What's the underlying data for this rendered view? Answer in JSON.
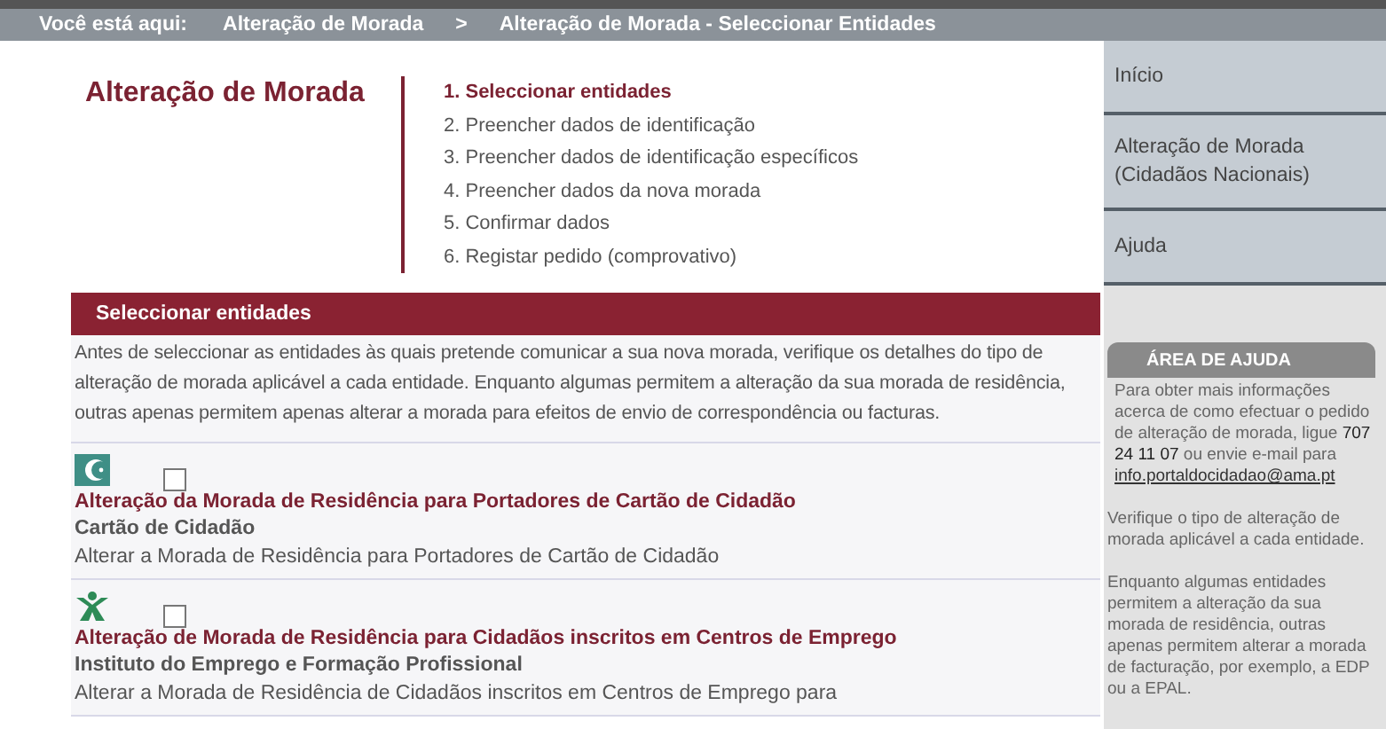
{
  "breadcrumb": {
    "label": "Você está aqui:",
    "items": [
      "Alteração de Morada",
      ">",
      "Alteração de Morada - Seleccionar Entidades"
    ]
  },
  "title": "Alteração de Morada",
  "steps": [
    {
      "label": "1. Seleccionar entidades",
      "selected": true
    },
    {
      "label": "2. Preencher dados de identificação",
      "selected": false
    },
    {
      "label": "3. Preencher dados de identificação específicos",
      "selected": false
    },
    {
      "label": "4. Preencher dados da nova morada",
      "selected": false
    },
    {
      "label": "5. Confirmar dados",
      "selected": false
    },
    {
      "label": "6. Registar pedido (comprovativo)",
      "selected": false
    }
  ],
  "section": {
    "heading": "Seleccionar entidades",
    "intro": "Antes de seleccionar as entidades às quais pretende comunicar a sua nova morada, verifique os detalhes do tipo de alteração de morada aplicável a cada entidade. Enquanto algumas permitem a alteração da sua morada de residência, outras apenas permitem apenas alterar a morada para efeitos de envio de correspondência ou facturas."
  },
  "entities": [
    {
      "kind": "card",
      "checked": false,
      "title": "Alteração da Morada de Residência para Portadores de Cartão de Cidadão",
      "entity": "Cartão de Cidadão",
      "description": "Alterar a Morada de Residência para Portadores de Cartão de Cidadão"
    },
    {
      "kind": "employment",
      "checked": false,
      "title": "Alteração de Morada de Residência para Cidadãos inscritos em Centros de Emprego",
      "entity": "Instituto do Emprego e Formação Profissional",
      "description": "Alterar a Morada de Residência de Cidadãos inscritos em Centros de Emprego para"
    }
  ],
  "sidebar": {
    "items": [
      "Início",
      "Alteração de Morada (Cidadãos Nacionais)",
      "Ajuda"
    ],
    "help": {
      "heading": "ÁREA DE AJUDA",
      "text": "Para obter mais informações acerca de como efectuar o pedido de alteração de morada, ligue **707 24 11 07** ou envie e-mail para",
      "email": "info.portaldocidadao@ama.pt",
      "notes": [
        "Verifique o tipo de alteração de morada aplicável a cada entidade.",
        "Enquanto algumas entidades permitem a alteração da sua morada de residência, outras apenas permitem alterar a morada de facturação, por exemplo, a EDP ou a EPAL."
      ]
    }
  }
}
